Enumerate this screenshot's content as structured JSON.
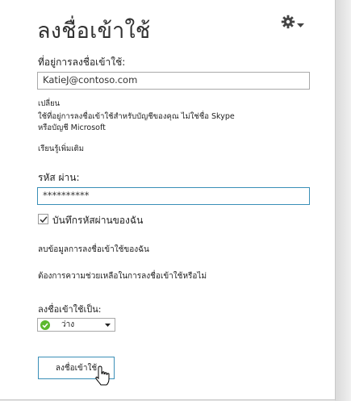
{
  "title": "ลงชื่อเข้าใช้",
  "signin_address": {
    "label": "ที่อยู่การลงชื่อเข้าใช้:",
    "value": "KatieJ@contoso.com"
  },
  "change": {
    "link": "เปลี่ยน",
    "desc_line1": "ใช้ที่อยู่การลงชื่อเข้าใช้สำหรับบัญชีของคุณ ไม่ใช่ชื่อ Skype",
    "desc_line2": "หรือบัญชี Microsoft"
  },
  "learn_more": "เรียนรู้เพิ่มเติม",
  "password": {
    "label": "รหัส ผ่าน:",
    "value": "**********"
  },
  "save_password": {
    "label": "บันทึกรหัสผ่านของฉัน",
    "checked": true
  },
  "delete_info": "ลบข้อมูลการลงชื่อเข้าใช้ของฉัน",
  "help": "ต้องการความช่วยเหลือในการลงชื่อเข้าใช้หรือไม่",
  "signin_as": {
    "label": "ลงชื่อเข้าใช้เป็น:",
    "status": "ว่าง",
    "status_color": "#5cb82e"
  },
  "signin_button": "ลงชื่อเข้าใช้",
  "colors": {
    "accent": "#3a8fb7"
  }
}
